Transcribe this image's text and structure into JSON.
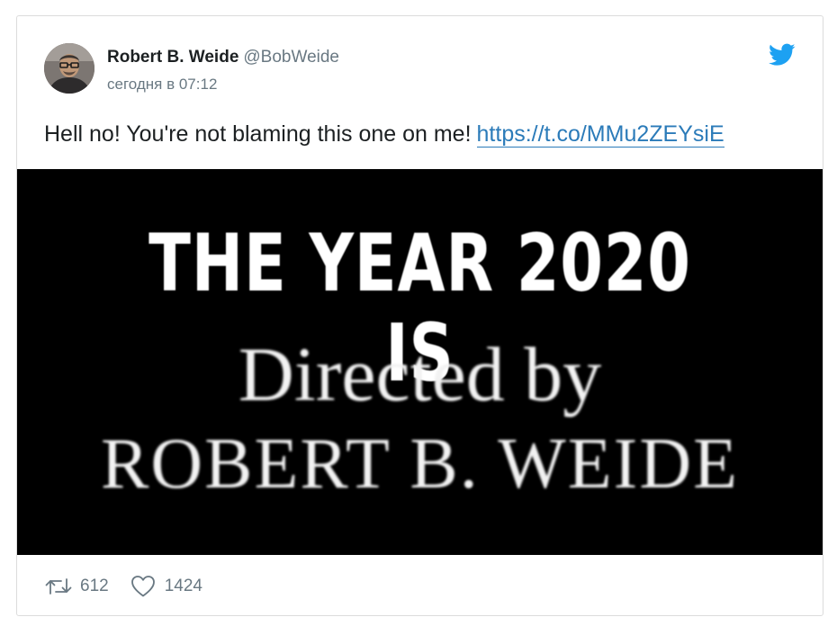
{
  "tweet": {
    "author_name": "Robert B. Weide",
    "author_handle": "@BobWeide",
    "timestamp": "сегодня в 07:12",
    "text": "Hell no! You're not blaming this one on me!",
    "link_text": "https://t.co/MMu2ZEYsiE",
    "retweet_count": "612",
    "like_count": "1424"
  },
  "media": {
    "line1": "THE YEAR 2020 IS",
    "line2": "Directed by",
    "line3": "ROBERT B. WEIDE"
  },
  "icons": {
    "bird": "twitter-bird-icon",
    "retweet": "retweet-icon",
    "like": "heart-icon"
  },
  "colors": {
    "brand_blue": "#1da1f2",
    "link_blue": "#2b7bb9",
    "muted_text": "#697882",
    "primary_text": "#1c2022"
  }
}
